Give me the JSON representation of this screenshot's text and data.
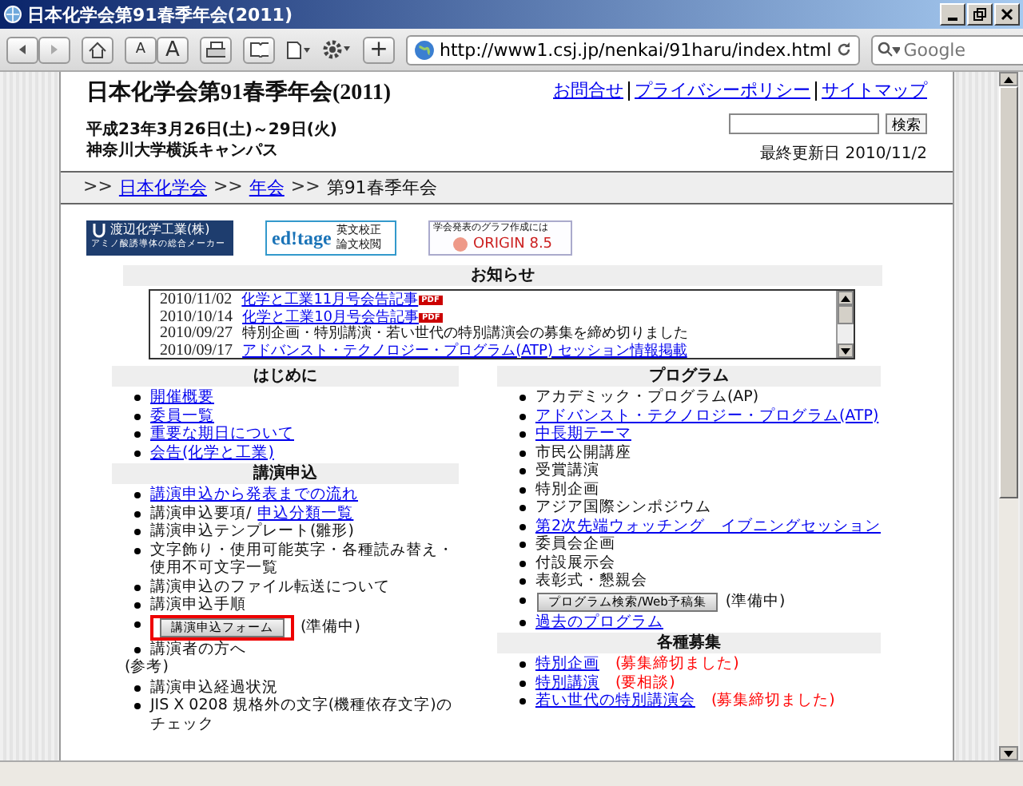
{
  "window": {
    "title": "日本化学会第91春季年会(2011)"
  },
  "toolbar": {
    "url": "http://www1.csj.jp/nenkai/91haru/index.html",
    "search_placeholder": "Google",
    "font_small": "A",
    "font_large": "A",
    "add": "+"
  },
  "header": {
    "title": "日本化学会第91春季年会(2011)",
    "links": [
      "お問合せ",
      "プライバシーポリシー",
      "サイトマップ"
    ],
    "date": "平成23年3月26日(土)～29日(火)",
    "venue": "神奈川大学横浜キャンパス",
    "search_button": "検索",
    "updated": "最終更新日 2010/11/2"
  },
  "breadcrumb": [
    {
      "text": "日本化学会",
      "link": true
    },
    {
      "text": "年会",
      "link": true
    },
    {
      "text": "第91春季年会",
      "link": false
    }
  ],
  "breadcrumb_separator": ">>",
  "banners": [
    {
      "kind": "watanabe",
      "lines": [
        "渡辺化学工業(株)",
        "アミノ酸誘導体の総合メーカー"
      ]
    },
    {
      "kind": "editage",
      "lines": [
        "ed!tage",
        "英文校正",
        "論文校閲"
      ]
    },
    {
      "kind": "origin",
      "lines": [
        "学会発表のグラフ作成には",
        "ORIGIN 8.5"
      ]
    }
  ],
  "news": {
    "heading": "お知らせ",
    "items": [
      {
        "date": "2010/11/02",
        "text": "化学と工業11月号会告記事",
        "link": true,
        "pdf": "PDF"
      },
      {
        "date": "2010/10/14",
        "text": "化学と工業10月号会告記事",
        "link": true,
        "pdf": "PDF"
      },
      {
        "date": "2010/09/27",
        "text": "特別企画・特別講演・若い世代の特別講演会の募集を締め切りました",
        "link": false
      },
      {
        "date": "2010/09/17",
        "text": "アドバンスト・テクノロジー・プログラム(ATP) セッション情報掲載",
        "link": true
      }
    ]
  },
  "columns": [
    [
      {
        "heading": "はじめに",
        "items": [
          {
            "kind": "link",
            "text": "開催概要"
          },
          {
            "kind": "link",
            "text": "委員一覧"
          },
          {
            "kind": "link",
            "text": "重要な期日について"
          },
          {
            "kind": "link",
            "text": "会告(化学と工業)"
          }
        ]
      },
      {
        "heading": "講演申込",
        "items": [
          {
            "kind": "link",
            "text": "講演申込から発表までの流れ"
          },
          {
            "kind": "pair",
            "text": "講演申込要項/",
            "link": "申込分類一覧"
          },
          {
            "kind": "text",
            "text": "講演申込テンプレート(雛形)"
          },
          {
            "kind": "text",
            "text": "文字飾り・使用可能英字・各種読み替え・使用不可文字一覧"
          },
          {
            "kind": "text",
            "text": "講演申込のファイル転送について"
          },
          {
            "kind": "text",
            "text": "講演申込手順"
          },
          {
            "kind": "button",
            "button": "講演申込フォーム",
            "note": "(準備中)",
            "highlighted": true
          },
          {
            "kind": "text",
            "text": "講演者の方へ"
          },
          {
            "kind": "plain",
            "text": "(参考)"
          },
          {
            "kind": "text",
            "text": "講演申込経過状況"
          },
          {
            "kind": "text",
            "text": "JIS X 0208 規格外の文字(機種依存文字)のチェック"
          }
        ]
      }
    ],
    [
      {
        "heading": "プログラム",
        "items": [
          {
            "kind": "text",
            "text": "アカデミック・プログラム(AP)"
          },
          {
            "kind": "link",
            "text": "アドバンスト・テクノロジー・プログラム(ATP)"
          },
          {
            "kind": "link",
            "text": "中長期テーマ"
          },
          {
            "kind": "text",
            "text": "市民公開講座"
          },
          {
            "kind": "text",
            "text": "受賞講演"
          },
          {
            "kind": "text",
            "text": "特別企画"
          },
          {
            "kind": "text",
            "text": "アジア国際シンポジウム"
          },
          {
            "kind": "link",
            "text": "第2次先端ウォッチング　イブニングセッション"
          },
          {
            "kind": "text",
            "text": "委員会企画"
          },
          {
            "kind": "text",
            "text": "付設展示会"
          },
          {
            "kind": "text",
            "text": "表彰式・懇親会"
          },
          {
            "kind": "button",
            "button": "プログラム検索/Web予稿集",
            "note": "(準備中)",
            "highlighted": false
          },
          {
            "kind": "link",
            "text": "過去のプログラム"
          }
        ]
      },
      {
        "heading": "各種募集",
        "items": [
          {
            "kind": "link",
            "text": "特別企画",
            "note": "(募集締切ました)"
          },
          {
            "kind": "link",
            "text": "特別講演",
            "note": "(要相談)"
          },
          {
            "kind": "link",
            "text": "若い世代の特別講演会",
            "note": "(募集締切ました)"
          }
        ]
      }
    ]
  ]
}
